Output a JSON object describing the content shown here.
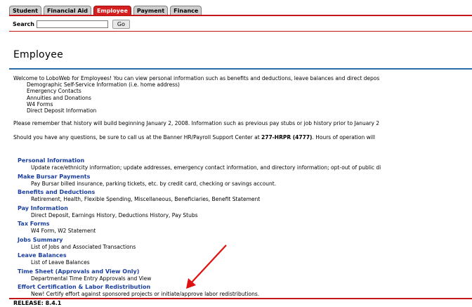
{
  "tabs": [
    {
      "label": "Student",
      "active": false
    },
    {
      "label": "Financial Aid",
      "active": false
    },
    {
      "label": "Employee",
      "active": true
    },
    {
      "label": "Payment",
      "active": false
    },
    {
      "label": "Finance",
      "active": false
    }
  ],
  "search": {
    "label": "Search",
    "value": "",
    "go_label": "Go"
  },
  "page_title": "Employee",
  "intro": {
    "text": "Welcome to LoboWeb for Employees! You can view personal information such as benefits and deductions, leave balances and direct depos",
    "items": [
      "Demographic Self-Service Information (i.e. home address)",
      "Emergency Contacts",
      "Annuities and Donations",
      "W4 Forms",
      "Direct Deposit Information"
    ],
    "history_note": "Please remember that history will build beginning January 2, 2008. Information such as previous pay stubs or job history prior to January 2",
    "support_prefix": "Should you have any questions, be sure to call us at the Banner HR/Payroll Support Center at ",
    "support_phone": "277-HRPR (4777)",
    "support_suffix": ". Hours of operation will"
  },
  "menu": [
    {
      "title": "Personal Information",
      "desc": "Update race/ethnicity information; update addresses, emergency contact information, and directory information; opt-out of public di"
    },
    {
      "title": "Make Bursar Payments",
      "desc": "Pay Bursar billed insurance, parking tickets, etc. by credit card, checking or savings account."
    },
    {
      "title": "Benefits and Deductions",
      "desc": "Retirement, Health, Flexible Spending, Miscellaneous, Beneficiaries, Benefit Statement"
    },
    {
      "title": "Pay Information",
      "desc": "Direct Deposit, Earnings History, Deductions History, Pay Stubs"
    },
    {
      "title": "Tax Forms",
      "desc": "W4 Form, W2 Statement"
    },
    {
      "title": "Jobs Summary",
      "desc": "List of Jobs and Associated Transactions"
    },
    {
      "title": "Leave Balances",
      "desc": "List of Leave Balances"
    },
    {
      "title": "Time Sheet (Approvals and View Only)",
      "desc": "Departmental Time Entry Approvals and View"
    },
    {
      "title": "Effort Certification & Labor Redistribution",
      "desc": "New! Certify effort against sponsored projects or initiate/approve labor redistributions."
    }
  ],
  "release": "RELEASE: 8.4.1",
  "colors": {
    "accent_red": "#c41818",
    "link_blue": "#1a3fa0",
    "rule_blue": "#2c6aa8",
    "annotation_arrow": "#e01010"
  }
}
